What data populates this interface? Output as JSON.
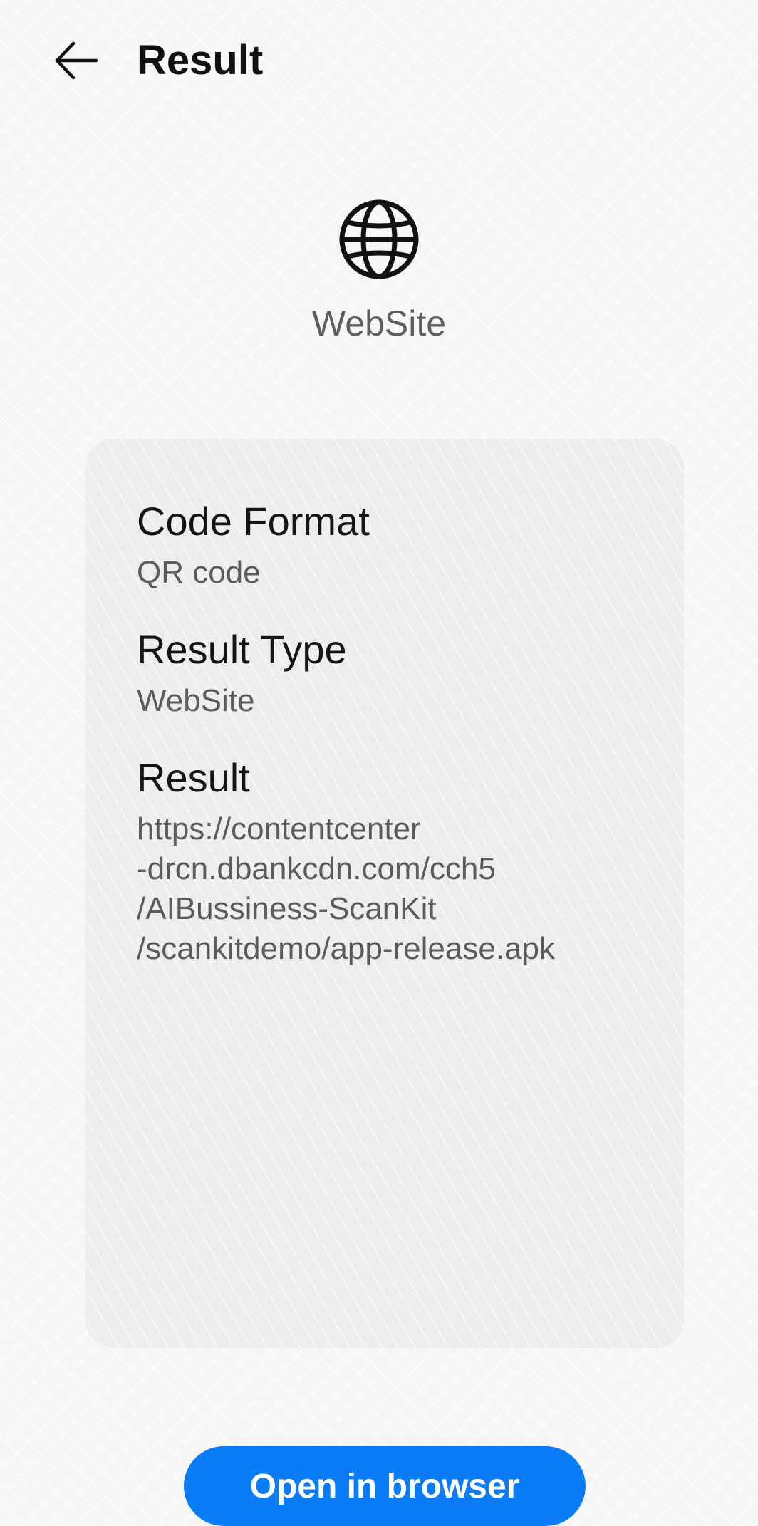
{
  "header": {
    "back_icon": "arrow-left-icon",
    "title": "Result"
  },
  "hero": {
    "icon": "globe-icon",
    "label": "WebSite"
  },
  "card": {
    "fields": [
      {
        "label": "Code Format",
        "value": "QR code"
      },
      {
        "label": "Result Type",
        "value": "WebSite"
      },
      {
        "label": "Result",
        "value": "https://contentcenter\n-drcn.dbankcdn.com/cch5\n/AIBussiness-ScanKit\n/scankitdemo/app-release.apk"
      }
    ]
  },
  "actions": {
    "open_browser_label": "Open in browser"
  },
  "colors": {
    "accent": "#0a7cf7",
    "background": "#f6f6f6",
    "card": "#eaeaea"
  }
}
